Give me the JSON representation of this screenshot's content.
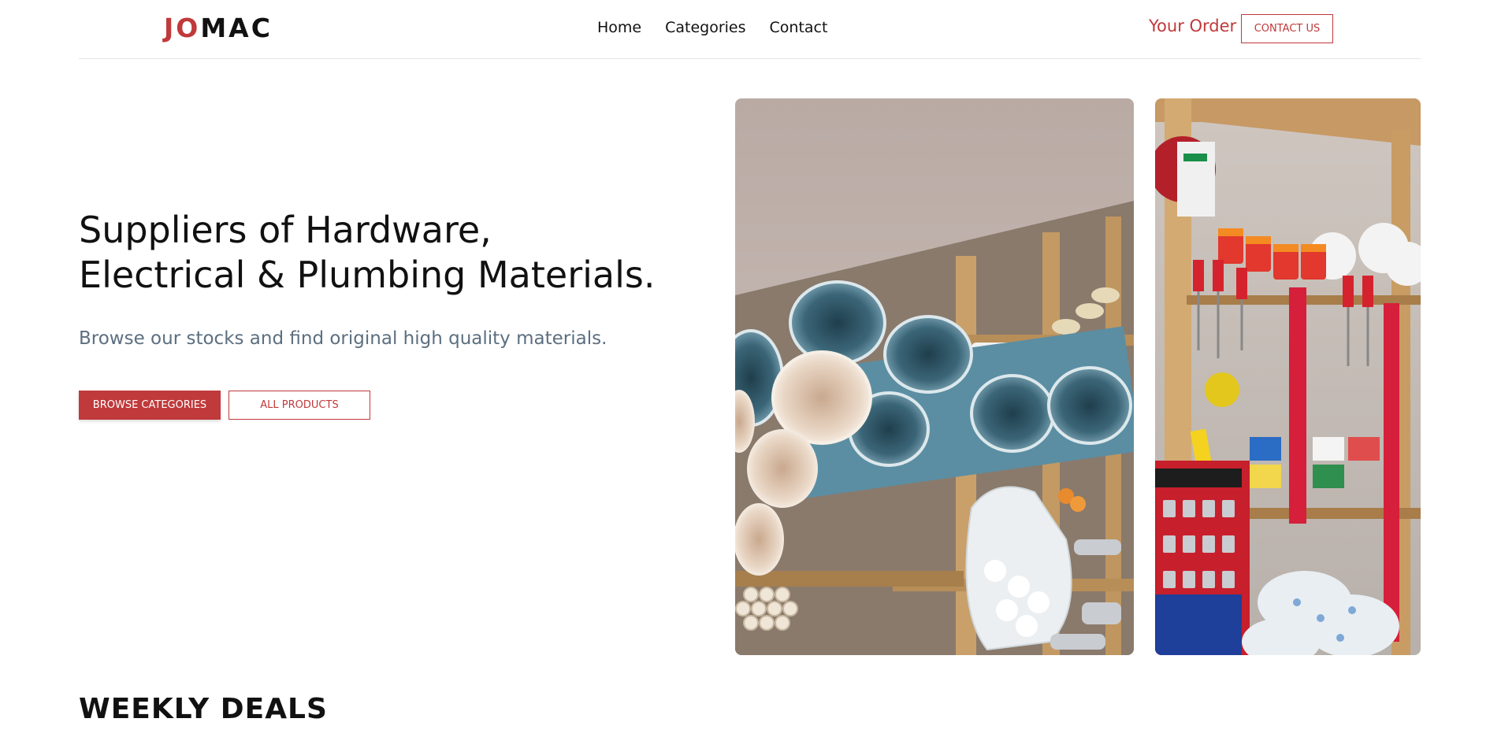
{
  "header": {
    "logo_accent": "JO",
    "logo_rest": "MAC",
    "nav": [
      "Home",
      "Categories",
      "Contact"
    ],
    "your_order": "Your Order",
    "contact_button": "CONTACT US"
  },
  "hero": {
    "title_line1": "Suppliers of Hardware,",
    "title_line2": "Electrical & Plumbing Materials.",
    "subtitle": "Browse our stocks and find original high quality materials.",
    "browse_button": "BROWSE CATEGORIES",
    "products_button": "ALL PRODUCTS"
  },
  "deals": {
    "title": "WEEKLY DEALS"
  },
  "colors": {
    "accent": "#c0393b",
    "subtitle": "#5c6f80"
  }
}
